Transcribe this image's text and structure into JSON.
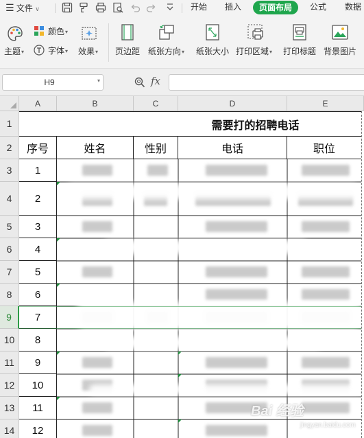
{
  "menu": {
    "file_label": "文件",
    "tabs": [
      {
        "label": "开始",
        "active": false
      },
      {
        "label": "插入",
        "active": false
      },
      {
        "label": "页面布局",
        "active": true
      },
      {
        "label": "公式",
        "active": false
      },
      {
        "label": "数据",
        "active": false
      }
    ],
    "quick_icons": [
      "save-icon",
      "format-painter-icon",
      "print-icon",
      "print-preview-icon",
      "undo-icon",
      "redo-icon",
      "more-dropdown-icon"
    ],
    "accent_color": "#1fa64d"
  },
  "ribbon": {
    "theme_label": "主题",
    "colors_label": "颜色",
    "fonts_label": "字体",
    "effects_label": "效果",
    "margins_label": "页边距",
    "orientation_label": "纸张方向",
    "size_label": "纸张大小",
    "print_area_label": "打印区域",
    "print_titles_label": "打印标题",
    "background_label": "背景图片"
  },
  "formula_bar": {
    "name_box": "H9",
    "fx_label": "fx",
    "value": ""
  },
  "sheet": {
    "columns": [
      "A",
      "B",
      "C",
      "D",
      "E"
    ],
    "rows": [
      "1",
      "2",
      "3",
      "4",
      "5",
      "6",
      "7",
      "8",
      "9",
      "10",
      "11",
      "12",
      "13",
      "14"
    ],
    "selected_row": "9",
    "title": "需要打的招聘电话",
    "headers": [
      "序号",
      "姓名",
      "性别",
      "电话",
      "职位"
    ],
    "serials": [
      "1",
      "2",
      "3",
      "4",
      "5",
      "6",
      "7",
      "8",
      "9",
      "10",
      "11",
      "12"
    ]
  },
  "watermark": {
    "text": "Bai 经验",
    "sub": "jingyan.baidu.com"
  }
}
